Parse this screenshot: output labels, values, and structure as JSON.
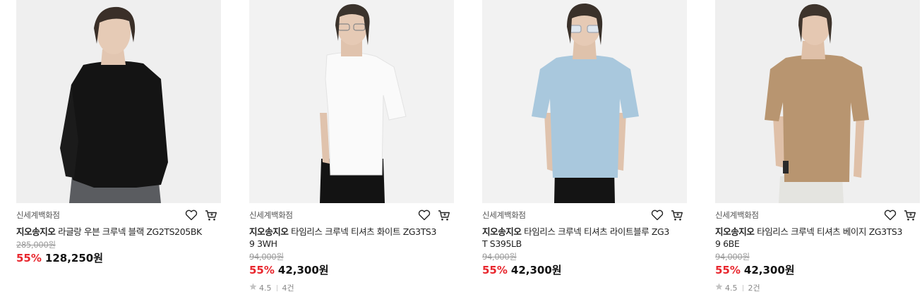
{
  "colors": {
    "discount": "#e8262d",
    "thumb_bg": "#f1f1f1"
  },
  "products": [
    {
      "store": "신세계백화점",
      "brand": "지오송지오",
      "name": "라글랑 우븐 크루넥 블랙 ZG2TS205BK",
      "original_price": "285,000원",
      "discount": "55%",
      "price": "128,250",
      "price_unit": "원",
      "garment_color": "#141414"
    },
    {
      "store": "신세계백화점",
      "brand": "지오송지오",
      "name": "타임리스 크루넥 티셔츠 화이트 ZG3TS39 3WH",
      "original_price": "94,000원",
      "discount": "55%",
      "price": "42,300",
      "price_unit": "원",
      "rating": "4.5",
      "reviews": "4건",
      "garment_color": "#fafafa"
    },
    {
      "store": "신세계백화점",
      "brand": "지오송지오",
      "name": "타임리스 크루넥 티셔츠 라이트블루 ZG3T S395LB",
      "original_price": "94,000원",
      "discount": "55%",
      "price": "42,300",
      "price_unit": "원",
      "garment_color": "#a9c8dd"
    },
    {
      "store": "신세계백화점",
      "brand": "지오송지오",
      "name": "타임리스 크루넥 티셔츠 베이지 ZG3TS39 6BE",
      "original_price": "94,000원",
      "discount": "55%",
      "price": "42,300",
      "price_unit": "원",
      "rating": "4.5",
      "reviews": "2건",
      "garment_color": "#b89570"
    }
  ]
}
